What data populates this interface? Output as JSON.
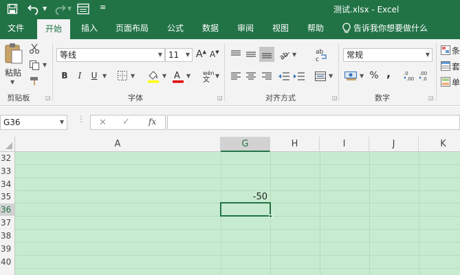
{
  "title_bar": {
    "title": "测试.xlsx",
    "separator": " - ",
    "app": "Excel"
  },
  "tabs": [
    {
      "label": "文件"
    },
    {
      "label": "开始"
    },
    {
      "label": "插入"
    },
    {
      "label": "页面布局"
    },
    {
      "label": "公式"
    },
    {
      "label": "数据"
    },
    {
      "label": "审阅"
    },
    {
      "label": "视图"
    },
    {
      "label": "帮助"
    }
  ],
  "tell_me": "告诉我你想要做什么",
  "ribbon": {
    "paste_label": "粘贴",
    "font_name": "等线",
    "font_size": "11",
    "number_format": "常规",
    "groups": {
      "clipboard": "剪贴板",
      "font": "字体",
      "alignment": "对齐方式",
      "number": "数字"
    },
    "bold": "B",
    "italic": "I",
    "underline": "U",
    "percent": "%",
    "comma": ",",
    "side_labels": [
      "条",
      "套",
      "单"
    ]
  },
  "formula_bar": {
    "name_box": "G36",
    "fx": "fx",
    "formula": ""
  },
  "columns": [
    "A",
    "G",
    "H",
    "I",
    "J",
    "K"
  ],
  "rows": [
    "32",
    "33",
    "34",
    "35",
    "36",
    "37",
    "38",
    "39",
    "40"
  ],
  "cells": {
    "G35": "-50"
  },
  "selected_cell": "G36",
  "colors": {
    "excel_green": "#217346",
    "sheet_fill": "#c7ebcf"
  }
}
